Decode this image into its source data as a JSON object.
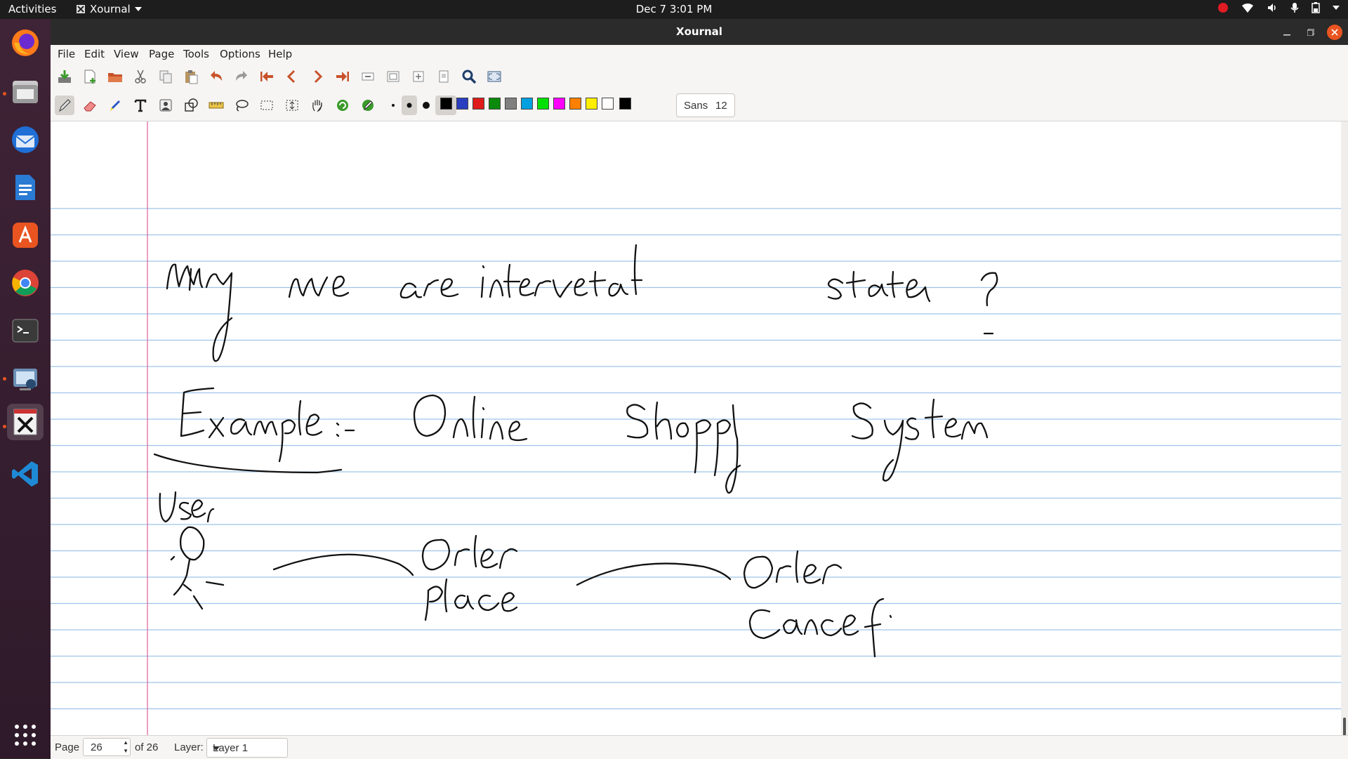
{
  "topbar": {
    "activities": "Activities",
    "app_name": "Xournal",
    "clock": "Dec 7  3:01 PM",
    "tray_icons": [
      "record-indicator-icon",
      "wifi-icon",
      "volume-icon",
      "microphone-icon",
      "battery-icon",
      "system-menu-icon"
    ]
  },
  "dock": {
    "items": [
      "firefox-icon",
      "files-icon",
      "thunderbird-icon",
      "libreoffice-writer-icon",
      "app-center-icon",
      "chrome-icon",
      "terminal-icon",
      "screenshot-tool-icon",
      "xournal-icon",
      "vscode-icon",
      "show-apps-icon"
    ]
  },
  "window": {
    "title": "Xournal"
  },
  "menu": {
    "file": "File",
    "edit": "Edit",
    "view": "View",
    "page": "Page",
    "tools": "Tools",
    "options": "Options",
    "help": "Help"
  },
  "toolbar": {
    "font_name": "Sans",
    "font_size": "12",
    "pen_colors": [
      "#000000",
      "#2a3fbf",
      "#e01b1b",
      "#0b8a0b",
      "#808080",
      "#00a0e0",
      "#00e000",
      "#ff00ff",
      "#ff8000",
      "#ffee00",
      "#ffffff",
      "#000000"
    ]
  },
  "page": {
    "ruling_color": "#9ec3e6",
    "margin_color": "#e06aa0",
    "handwriting": {
      "line1": "Why we are interested states ?",
      "line2": "Example :- Online Shopping System",
      "user_label": "User",
      "actions": [
        "Order place",
        "Order Cancel"
      ]
    }
  },
  "status": {
    "page_label": "Page",
    "page_value": "26",
    "of_total": "of 26",
    "layer_label": "Layer:",
    "layer_value": "Layer 1"
  }
}
